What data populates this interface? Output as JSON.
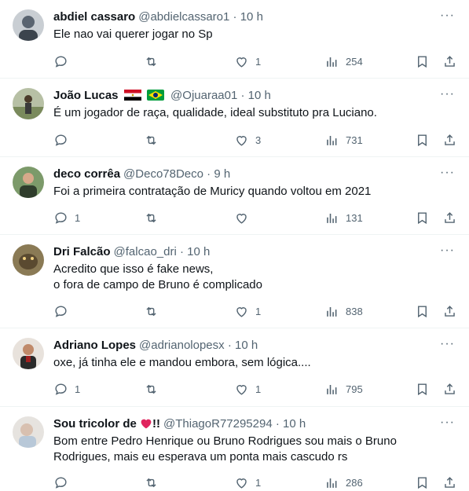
{
  "replies": [
    {
      "name": "abdiel cassaro",
      "handle": "@abdielcassaro1",
      "time": "10 h",
      "text_lines": [
        "Ele nao vai querer jogar no Sp"
      ],
      "replies": "",
      "reposts": "",
      "likes": "1",
      "views": "254",
      "avatar_color": "#5a6470"
    },
    {
      "name": "João Lucas",
      "handle": "@Ojuaraa01",
      "time": "10 h",
      "text_lines": [
        "É um jogador de raça, qualidade, ideal substituto pra Luciano."
      ],
      "replies": "",
      "reposts": "",
      "likes": "3",
      "views": "731",
      "avatar_color": "#7a8a5c",
      "name_emojis": [
        "flag-egypt-icon",
        "flag-brazil-icon"
      ]
    },
    {
      "name": "deco corrêa",
      "handle": "@Deco78Deco",
      "time": "9 h",
      "text_lines": [
        "Foi a primeira contratação de Muricy quando voltou em 2021"
      ],
      "replies": "1",
      "reposts": "",
      "likes": "",
      "views": "131",
      "avatar_color": "#3e5a3a"
    },
    {
      "name": "Dri Falcão",
      "handle": "@falcao_dri",
      "time": "10 h",
      "text_lines": [
        "Acredito que isso é fake news,",
        "o fora de campo de Bruno é complicado"
      ],
      "replies": "",
      "reposts": "",
      "likes": "1",
      "views": "838",
      "avatar_color": "#6b5a3a"
    },
    {
      "name": "Adriano Lopes",
      "handle": "@adrianolopesx",
      "time": "10 h",
      "text_lines": [
        "oxe, já tinha ele e mandou embora, sem lógica...."
      ],
      "replies": "1",
      "reposts": "",
      "likes": "1",
      "views": "795",
      "avatar_color": "#a06a4a"
    },
    {
      "name": "Sou tricolor de",
      "name_suffix": "!!",
      "handle": "@ThiagoR77295294",
      "time": "10 h",
      "text_lines": [
        "Bom entre Pedro Henrique ou Bruno Rodrigues sou mais o Bruno",
        "Rodrigues, mais eu esperava um ponta mais cascudo rs"
      ],
      "replies": "",
      "reposts": "",
      "likes": "1",
      "views": "286",
      "avatar_color": "#d8d4d0",
      "name_emojis": [
        "red-heart-icon"
      ]
    }
  ],
  "ui": {
    "dot": "·",
    "more": "···",
    "accent_gray": "#536471",
    "heart_red": "#e0245e"
  }
}
